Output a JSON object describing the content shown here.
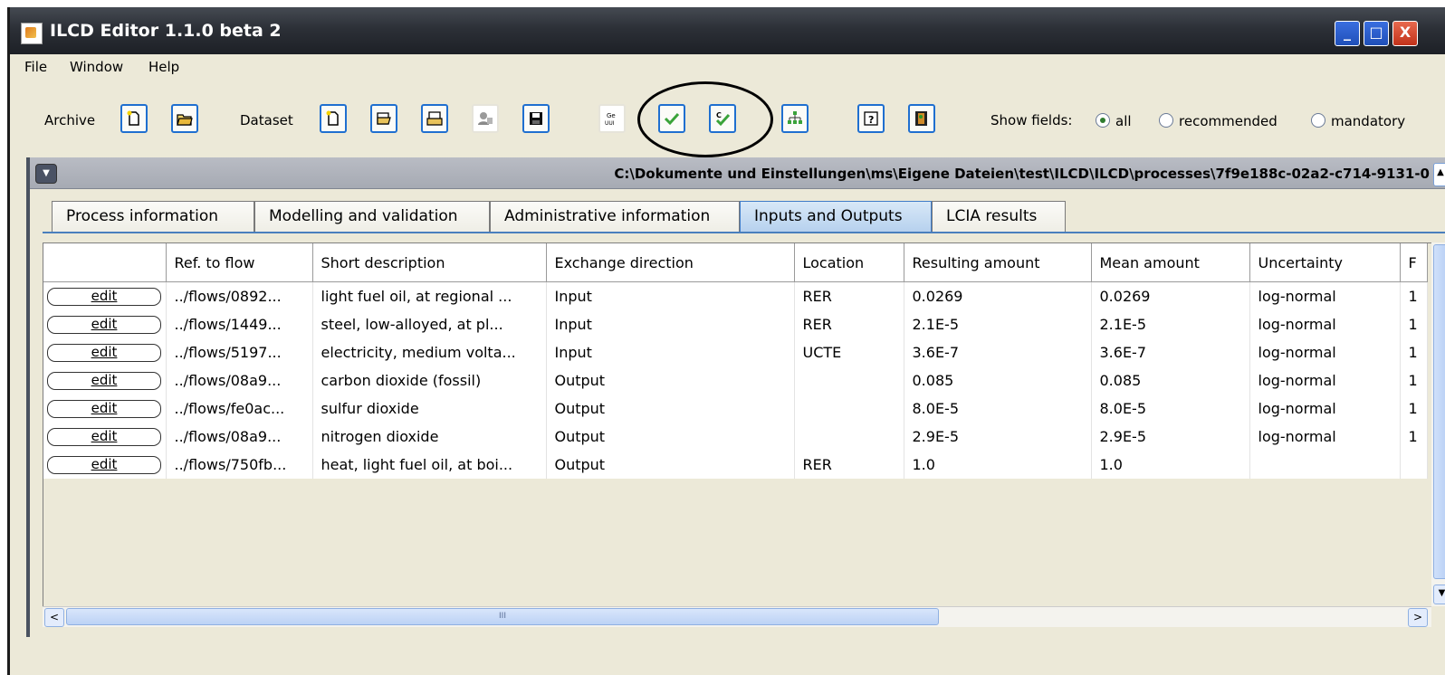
{
  "window": {
    "title": "ILCD Editor 1.1.0 beta 2",
    "minimize": "_",
    "maximize": "□",
    "close": "X"
  },
  "menu": [
    "File",
    "Window",
    "Help"
  ],
  "toolbar": {
    "archive_label": "Archive",
    "dataset_label": "Dataset",
    "show_fields_label": "Show fields:",
    "radio_options": [
      "all",
      "recommended",
      "mandatory"
    ],
    "selected_option": "all",
    "icons": [
      "new-archive-icon",
      "open-archive-icon",
      "new-dataset-icon",
      "open-dataset-icon",
      "import-dataset-icon",
      "user-icon",
      "save-icon",
      "generate-uuid-icon",
      "validate-icon",
      "check-compliance-icon",
      "hierarchy-icon",
      "help-icon",
      "exit-icon"
    ]
  },
  "frame": {
    "path": "C:\\Dokumente und Einstellungen\\ms\\Eigene Dateien\\test\\ILCD\\ILCD\\processes\\7f9e188c-02a2-c714-9131-0"
  },
  "tabs": [
    "Process information",
    "Modelling and validation",
    "Administrative information",
    "Inputs and Outputs",
    "LCIA results"
  ],
  "active_tab": "Inputs and Outputs",
  "table": {
    "headers": [
      "",
      "Ref. to flow",
      "Short description",
      "Exchange direction",
      "Location",
      "Resulting amount",
      "Mean amount",
      "Uncertainty",
      "F"
    ],
    "edit_label": "edit",
    "rows": [
      [
        "../flows/0892...",
        "light fuel oil, at regional ...",
        "Input",
        "RER",
        "0.0269",
        "0.0269",
        "log-normal",
        "1"
      ],
      [
        "../flows/1449...",
        "steel, low-alloyed, at pl...",
        "Input",
        "RER",
        "2.1E-5",
        "2.1E-5",
        "log-normal",
        "1"
      ],
      [
        "../flows/5197...",
        "electricity, medium volta...",
        "Input",
        "UCTE",
        "3.6E-7",
        "3.6E-7",
        "log-normal",
        "1"
      ],
      [
        "../flows/08a9...",
        "carbon dioxide (fossil)",
        "Output",
        "",
        "0.085",
        "0.085",
        "log-normal",
        "1"
      ],
      [
        "../flows/fe0ac...",
        "sulfur dioxide",
        "Output",
        "",
        "8.0E-5",
        "8.0E-5",
        "log-normal",
        "1"
      ],
      [
        "../flows/08a9...",
        "nitrogen dioxide",
        "Output",
        "",
        "2.9E-5",
        "2.9E-5",
        "log-normal",
        "1"
      ],
      [
        "../flows/750fb...",
        "heat, light fuel oil, at boi...",
        "Output",
        "RER",
        "1.0",
        "1.0",
        "",
        ""
      ]
    ]
  },
  "scrollbar": {
    "thumb_grip": "III"
  }
}
